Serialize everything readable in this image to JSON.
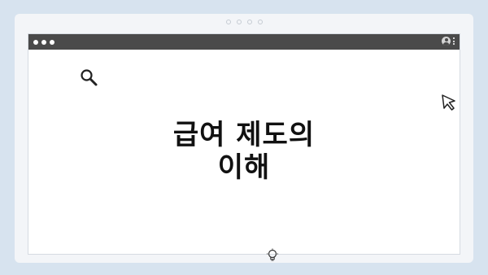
{
  "window": {
    "title_line1": "급여 제도의",
    "title_line2": "이해"
  },
  "icons": {
    "pagination": "pagination-dots",
    "search": "search-icon",
    "cursor": "cursor-arrow-icon",
    "bulb": "lightbulb-icon",
    "avatar": "user-avatar-icon",
    "menu": "kebab-menu-icon"
  },
  "colors": {
    "background": "#d7e3ef",
    "titlebar": "#4a4a4a",
    "window": "#ffffff",
    "text": "#111111"
  }
}
